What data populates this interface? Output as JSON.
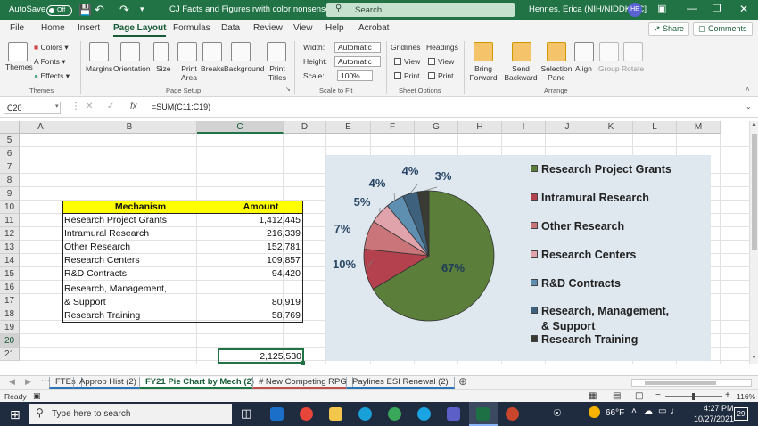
{
  "titlebar": {
    "autosave_label": "AutoSave",
    "autosave_state": "Off",
    "doc_title": "CJ Facts and Figures rwith color nonsense",
    "search_placeholder": "Search",
    "user_name": "Hennes, Erica (NIH/NIDDK) [C]",
    "user_initials": "HE"
  },
  "menu": {
    "items": [
      "File",
      "Home",
      "Insert",
      "Page Layout",
      "Formulas",
      "Data",
      "Review",
      "View",
      "Help",
      "Acrobat"
    ],
    "active": "Page Layout",
    "share_label": "Share",
    "comments_label": "Comments"
  },
  "ribbon": {
    "themes": {
      "themes_label": "Themes",
      "colors_label": "Colors",
      "fonts_label": "Fonts",
      "effects_label": "Effects",
      "group_label": "Themes"
    },
    "page_setup": {
      "margins": "Margins",
      "orientation": "Orientation",
      "size": "Size",
      "print_area": "Print Area",
      "breaks": "Breaks",
      "background": "Background",
      "print_titles": "Print Titles",
      "group_label": "Page Setup"
    },
    "scale_to_fit": {
      "width_label": "Width:",
      "width_value": "Automatic",
      "height_label": "Height:",
      "height_value": "Automatic",
      "scale_label": "Scale:",
      "scale_value": "100%",
      "group_label": "Scale to Fit"
    },
    "sheet_options": {
      "gridlines": "Gridlines",
      "headings": "Headings",
      "view": "View",
      "print": "Print",
      "group_label": "Sheet Options"
    },
    "arrange": {
      "bring_forward": "Bring Forward",
      "send_backward": "Send Backward",
      "selection_pane": "Selection Pane",
      "align": "Align",
      "group": "Group",
      "rotate": "Rotate",
      "group_label": "Arrange"
    }
  },
  "formula_bar": {
    "name_box": "C20",
    "fx": "fx",
    "formula": "=SUM(C11:C19)"
  },
  "grid": {
    "columns": [
      "A",
      "B",
      "C",
      "D",
      "E",
      "F",
      "G",
      "H",
      "I",
      "J",
      "K",
      "L",
      "M"
    ],
    "selected_column": "C",
    "rows": [
      "5",
      "6",
      "7",
      "8",
      "9",
      "10",
      "11",
      "12",
      "13",
      "14",
      "15",
      "16",
      "17",
      "18",
      "19",
      "20",
      "21"
    ],
    "selected_row": "20",
    "table_header": {
      "mechanism": "Mechanism",
      "amount": "Amount"
    },
    "table_rows": [
      {
        "mechanism": "Research Project Grants",
        "amount": "1,412,445"
      },
      {
        "mechanism": "Intramural Research",
        "amount": "216,339"
      },
      {
        "mechanism": "Other Research",
        "amount": "152,781"
      },
      {
        "mechanism": "Research Centers",
        "amount": "109,857"
      },
      {
        "mechanism": "R&D Contracts",
        "amount": "94,420"
      },
      {
        "mechanism": "Research, Management,",
        "amount": ""
      },
      {
        "mechanism": "& Support",
        "amount": "80,919"
      },
      {
        "mechanism": "Research Training",
        "amount": "58,769"
      }
    ],
    "total_cell": "2,125,530",
    "colors": {
      "header_fill": "#ffff00"
    }
  },
  "chart_data": {
    "type": "pie",
    "categories": [
      "Research Project Grants",
      "Intramural Research",
      "Other Research",
      "Research Centers",
      "R&D Contracts",
      "Research, Management, & Support",
      "Research Training"
    ],
    "values": [
      1412445,
      216339,
      152781,
      109857,
      94420,
      80919,
      58769
    ],
    "data_labels": [
      "67%",
      "10%",
      "7%",
      "5%",
      "4%",
      "4%",
      "3%"
    ],
    "colors": [
      "#5b7f3a",
      "#b3424e",
      "#c97579",
      "#e0a3ab",
      "#5e8fb1",
      "#3e627d",
      "#3b3b35"
    ],
    "legend": [
      "Research Project Grants",
      "Intramural Research",
      "Other Research",
      "Research Centers",
      "R&D Contracts",
      "Research, Management,",
      "& Support",
      "Research Training"
    ],
    "legend_position": "right",
    "background": "#dfe7ef"
  },
  "sheet_tabs": {
    "tabs": [
      {
        "label": "FTEs",
        "color": "#2e75b6"
      },
      {
        "label": "Approp Hist (2)",
        "color": "#2e75b6"
      },
      {
        "label": "FY21 Pie Chart by Mech (2)",
        "color": "#2e75b6"
      },
      {
        "label": "# New Competing RPG",
        "color": "#c0504d"
      },
      {
        "label": "Paylines ESI Renewal (2)",
        "color": "#2e75b6"
      }
    ],
    "active": "FY21 Pie Chart by Mech (2)"
  },
  "status_bar": {
    "ready": "Ready",
    "zoom": "116%"
  },
  "taskbar": {
    "search_placeholder": "Type here to search",
    "weather": "66°F",
    "time": "4:27 PM",
    "date": "10/27/2021",
    "notifications": "29"
  }
}
